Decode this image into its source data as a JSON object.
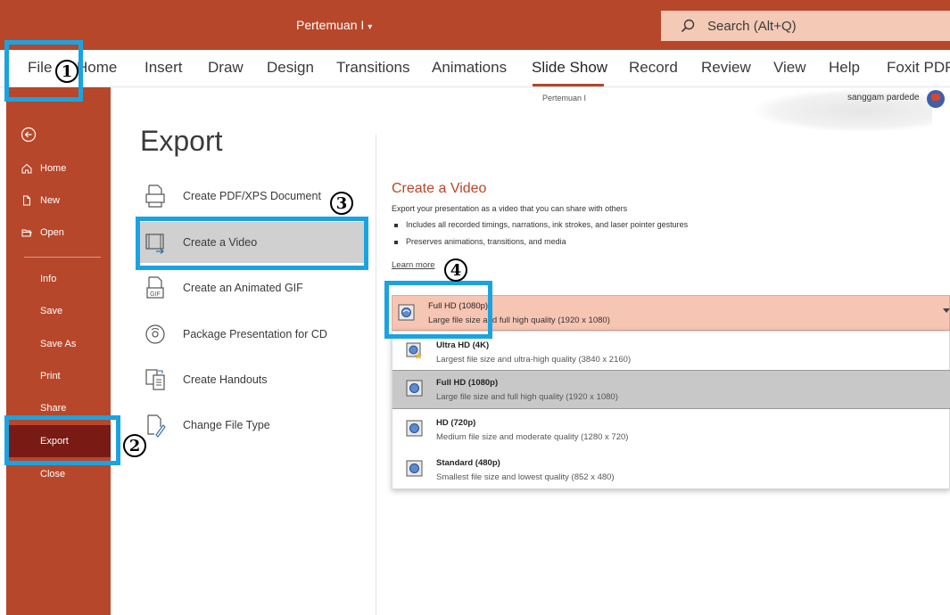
{
  "titlebar": {
    "doc_title": "Pertemuan I",
    "search_placeholder": "Search (Alt+Q)"
  },
  "ribbon": {
    "tabs": [
      "File",
      "Home",
      "Insert",
      "Draw",
      "Design",
      "Transitions",
      "Animations",
      "Slide Show",
      "Record",
      "Review",
      "View",
      "Help",
      "Foxit PDF"
    ],
    "active_tab": "Slide Show"
  },
  "backstage": {
    "doc_subtitle": "Pertemuan I",
    "user_name": "sanggam pardede",
    "nav": {
      "home": "Home",
      "new": "New",
      "open": "Open",
      "info": "Info",
      "save": "Save",
      "save_as": "Save As",
      "print": "Print",
      "share": "Share",
      "export": "Export",
      "close": "Close"
    },
    "title": "Export",
    "export_items": [
      "Create PDF/XPS Document",
      "Create a Video",
      "Create an Animated GIF",
      "Package Presentation for CD",
      "Create Handouts",
      "Change File Type"
    ],
    "selected_item": "Create a Video",
    "video": {
      "title": "Create a Video",
      "description": "Export your presentation as a video that you can share with others",
      "bullets": [
        "Includes all recorded timings, narrations, ink strokes, and laser pointer gestures",
        "Preserves animations, transitions, and media"
      ],
      "learn_more": "Learn more",
      "quality_selected": {
        "name": "Full HD (1080p)",
        "desc": "Large file size and full high quality (1920 x 1080)"
      },
      "quality_options": [
        {
          "name": "Ultra HD (4K)",
          "desc": "Largest file size and ultra-high quality (3840 x 2160)"
        },
        {
          "name": "Full HD (1080p)",
          "desc": "Large file size and full high quality (1920 x 1080)"
        },
        {
          "name": "HD (720p)",
          "desc": "Medium file size and moderate quality (1280 x 720)"
        },
        {
          "name": "Standard (480p)",
          "desc": "Smallest file size and lowest quality (852 x 480)"
        }
      ]
    }
  },
  "annotations": {
    "steps": [
      "1",
      "2",
      "3",
      "4"
    ],
    "highlight_color": "#1aa3e0"
  },
  "colors": {
    "accent": "#b7472a",
    "nav_selected": "#7a1a14",
    "dropdown_selected": "#f7c5b3"
  }
}
